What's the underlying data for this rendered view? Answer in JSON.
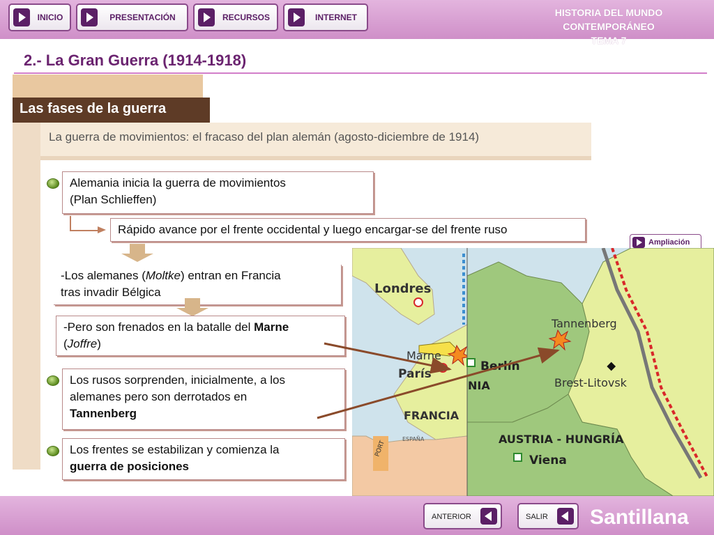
{
  "nav": {
    "inicio": "INICIO",
    "presentacion": "PRESENTACIÓN",
    "recursos": "RECURSOS",
    "internet": "INTERNET"
  },
  "course": {
    "line1": "HISTORIA DEL MUNDO CONTEMPORÁNEO",
    "line2": "TEMA 7"
  },
  "section_title": "2.- La Gran Guerra (1914-1918)",
  "tab_label": "Las fases de la guerra",
  "subtitle": "La guerra de movimientos: el fracaso del plan alemán (agosto-diciembre de 1914)",
  "content": {
    "box1": {
      "line1": "Alemania inicia la guerra de movimientos",
      "line2": "(Plan Schlieffen)"
    },
    "box2": "Rápido avance por el frente occidental y luego encargar-se del frente ruso",
    "box3": {
      "p1": "-Los alemanes (",
      "moltke": "Moltke",
      "p2": ") entran en Francia",
      "line2": "tras invadir Bélgica"
    },
    "box4": {
      "p1": "-Pero son frenados en la batalle del ",
      "marne": "Marne",
      "p2": "(",
      "joffre": "Joffre",
      "p3": ")"
    },
    "box5": {
      "line1": "Los rusos sorprenden, inicialmente, a los",
      "line2": "alemanes pero son derrotados en",
      "line3": "Tannenberg"
    },
    "box6": {
      "line1": "Los frentes se estabilizan y comienza la",
      "line2": "guerra de posiciones"
    }
  },
  "ampliacion": "Ampliación",
  "map": {
    "londres": "Londres",
    "marne": "Marne",
    "paris": "París",
    "francia": "FRANCIA",
    "espana": "ESPAÑA",
    "portugal": "PORT",
    "berlin": "Berlín",
    "nia": "NIA",
    "tannenberg": "Tannenberg",
    "brest": "Brest-Litovsk",
    "austria": "AUSTRIA - HUNGRÍA",
    "viena": "Viena",
    "colors": {
      "sea": "#cfe3ec",
      "land": "#e6ef9e",
      "central": "#9fc87d",
      "front": "#d8282a"
    }
  },
  "footer": {
    "anterior": "ANTERIOR",
    "salir": "SALIR",
    "brand": "Santillana"
  }
}
